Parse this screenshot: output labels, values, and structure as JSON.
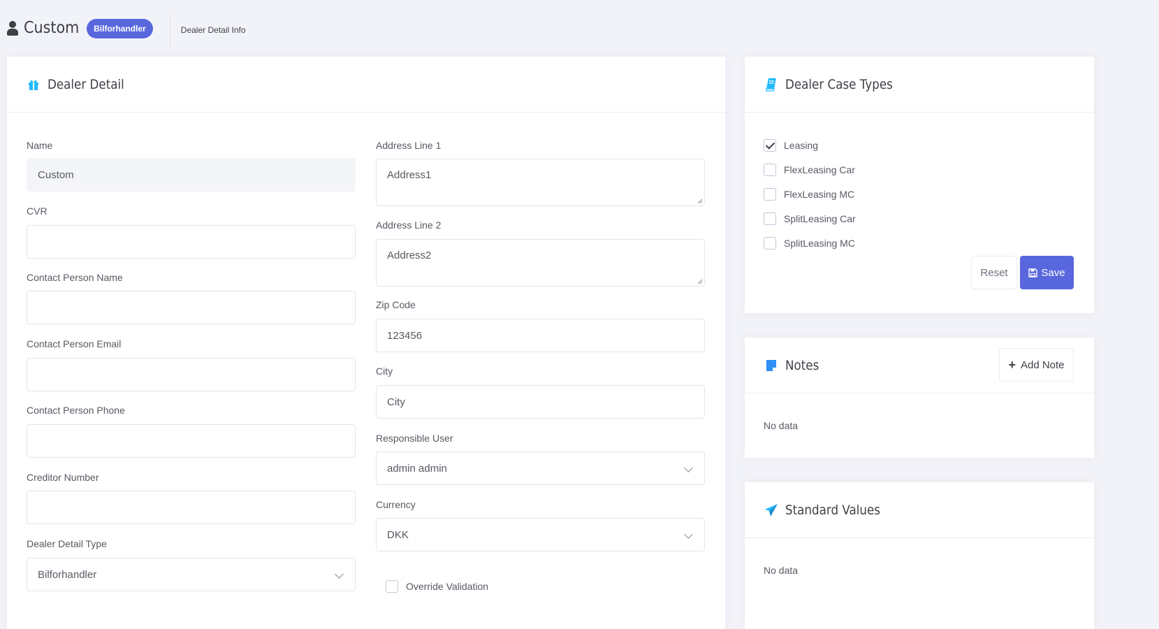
{
  "header": {
    "title": "Custom",
    "badge": "Bilforhandler",
    "breadcrumb": "Dealer Detail Info"
  },
  "dealer_detail": {
    "title": "Dealer Detail",
    "left": [
      {
        "label": "Name",
        "value": "Custom"
      },
      {
        "label": "CVR",
        "value": ""
      },
      {
        "label": "Contact Person Name",
        "value": ""
      },
      {
        "label": "Contact Person Email",
        "value": ""
      },
      {
        "label": "Contact Person Phone",
        "value": ""
      },
      {
        "label": "Creditor Number",
        "value": ""
      },
      {
        "label": "Dealer Detail Type",
        "value": "Bilforhandler"
      }
    ],
    "right": [
      {
        "label": "Address Line 1",
        "value": "Address1"
      },
      {
        "label": "Address Line 2",
        "value": "Address2"
      },
      {
        "label": "Zip Code",
        "value": "123456"
      },
      {
        "label": "City",
        "value": "City"
      },
      {
        "label": "Responsible User",
        "value": "admin admin"
      },
      {
        "label": "Currency",
        "value": "DKK"
      }
    ],
    "override_validation": {
      "label": "Override Validation",
      "checked": false
    }
  },
  "case_types": {
    "title": "Dealer Case Types",
    "items": [
      {
        "label": "Leasing",
        "checked": true
      },
      {
        "label": "FlexLeasing Car",
        "checked": false
      },
      {
        "label": "FlexLeasing MC",
        "checked": false
      },
      {
        "label": "SplitLeasing Car",
        "checked": false
      },
      {
        "label": "SplitLeasing MC",
        "checked": false
      }
    ],
    "reset_label": "Reset",
    "save_label": "Save"
  },
  "notes": {
    "title": "Notes",
    "add_label": "Add Note",
    "empty": "No data"
  },
  "standard_values": {
    "title": "Standard Values",
    "empty": "No data"
  },
  "colors": {
    "accent": "#5867dd",
    "icon_blue": "#22b9ff",
    "notes_icon": "#2f8ff5"
  }
}
